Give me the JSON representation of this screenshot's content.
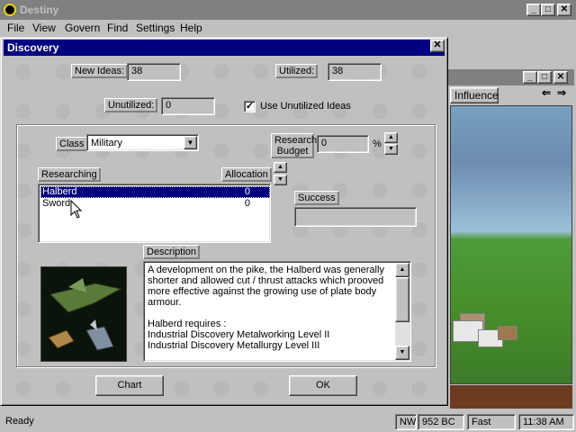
{
  "app": {
    "title": "Destiny",
    "menu": [
      "File",
      "View",
      "Govern",
      "Find",
      "Settings",
      "Help"
    ],
    "window_buttons": [
      "_",
      "□",
      "✕"
    ]
  },
  "world_view": {
    "tab": "Influence",
    "nav_left": "⇐",
    "nav_right": "⇒",
    "window_buttons": [
      "_",
      "□",
      "✕"
    ]
  },
  "dialog": {
    "title": "Discovery",
    "close": "✕",
    "new_ideas_label": "New Ideas:",
    "new_ideas_value": "38",
    "utilized_label": "Utilized:",
    "utilized_value": "38",
    "unutilized_label": "Unutilized:",
    "unutilized_value": "0",
    "use_unutilized_label": "Use Unutilized Ideas",
    "use_unutilized_checked": "✓",
    "class_label": "Class",
    "class_value": "Military",
    "research_budget_label": "Research Budget",
    "research_budget_value": "0",
    "percent": "%",
    "researching_label": "Researching",
    "allocation_label": "Allocation",
    "success_label": "Success",
    "success_value": "",
    "description_label": "Description",
    "research_items": [
      {
        "name": "Halberd",
        "allocation": "0",
        "selected": true
      },
      {
        "name": "Sword",
        "allocation": "0",
        "selected": false
      }
    ],
    "description": "A development on the pike, the Halberd was generally shorter and allowed cut / thrust attacks which prooved more effective against the growing use of plate body armour.\n\nHalberd requires :\nIndustrial Discovery Metalworking Level II\nIndustrial Discovery Metallurgy Level III",
    "chart_button": "Chart",
    "ok_button": "OK"
  },
  "statusbar": {
    "status": "Ready",
    "direction": "NW",
    "year": "952 BC",
    "speed": "Fast",
    "time": "11:38 AM"
  },
  "colors": {
    "title_active": "#000080",
    "title_inactive": "#808080",
    "face": "#c0c0c0"
  }
}
